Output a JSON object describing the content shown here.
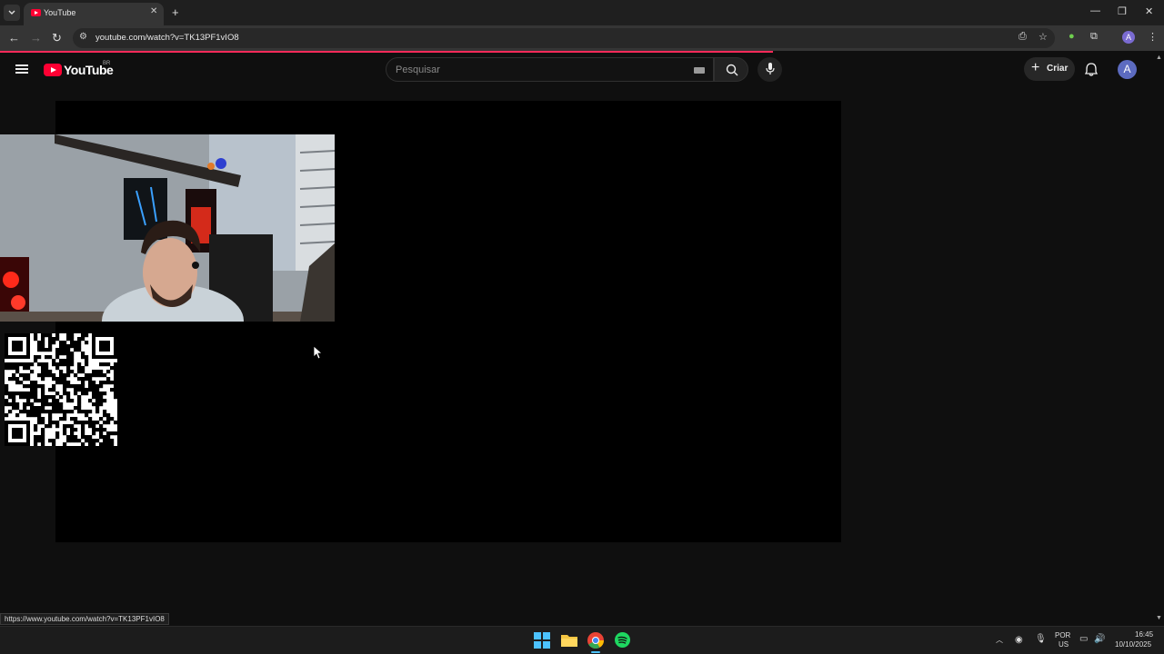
{
  "browser": {
    "tab": {
      "title": "YouTube"
    },
    "url": "youtube.com/watch?v=TK13PF1vIO8",
    "status_url": "https://www.youtube.com/watch?v=TK13PF1vIO8",
    "profile_initial": "A"
  },
  "youtube": {
    "logo_text": "YouTube",
    "country_code": "BR",
    "search_placeholder": "Pesquisar",
    "create_label": "Criar",
    "avatar_initial": "A"
  },
  "taskbar": {
    "language": "POR",
    "layout": "US",
    "time": "16:45",
    "date": "10/10/2025",
    "apps": [
      "windows-start",
      "file-explorer",
      "chrome",
      "spotify"
    ]
  },
  "colors": {
    "yt_red": "#ff0033",
    "progress": "#ff2a5a",
    "background": "#0f0f0f"
  }
}
